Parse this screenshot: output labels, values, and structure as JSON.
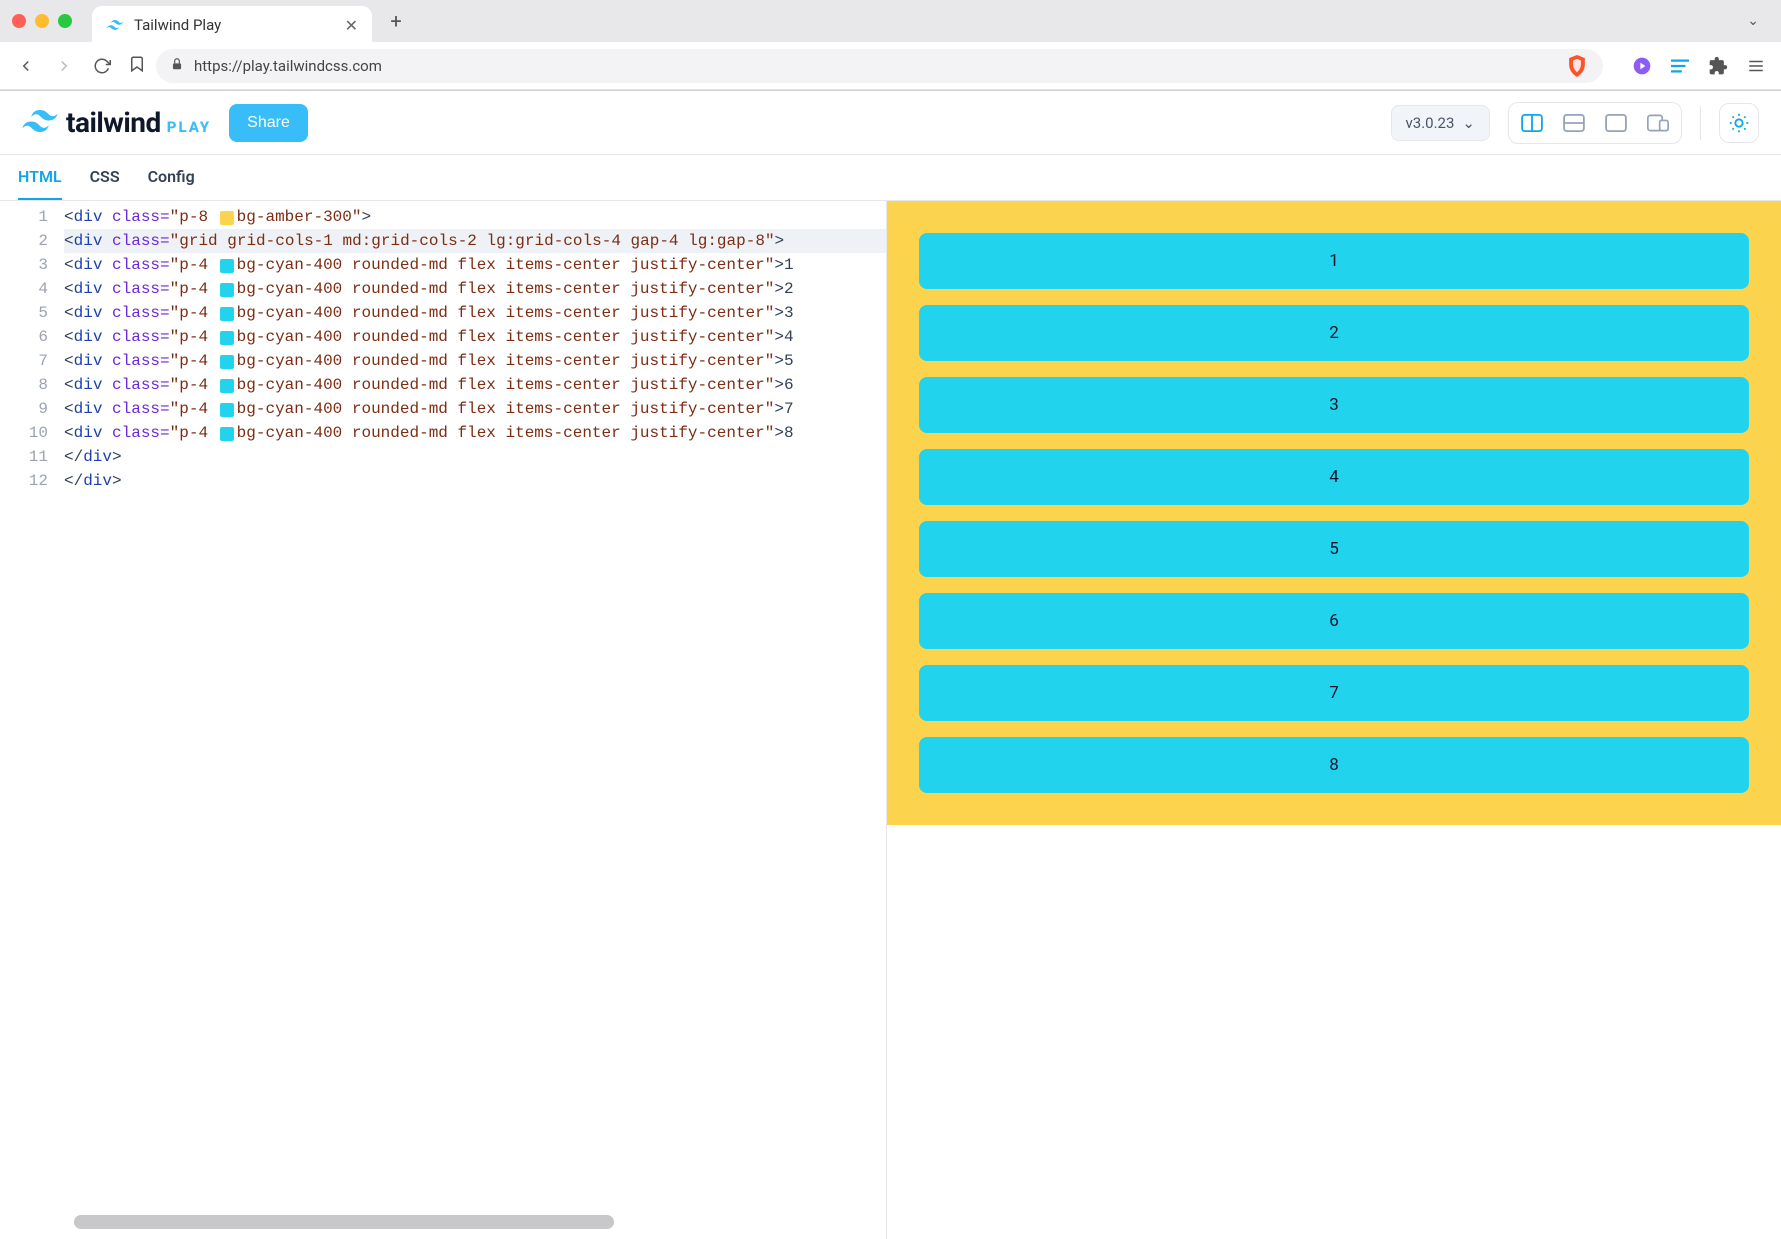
{
  "browser": {
    "tab_title": "Tailwind Play",
    "url": "https://play.tailwindcss.com"
  },
  "header": {
    "logo_text": "tailwind",
    "logo_play": "PLAY",
    "share_label": "Share",
    "version_label": "v3.0.23"
  },
  "editor_tabs": {
    "html": "HTML",
    "css": "CSS",
    "config": "Config"
  },
  "code": {
    "line_numbers": [
      "1",
      "2",
      "3",
      "4",
      "5",
      "6",
      "7",
      "8",
      "9",
      "10",
      "11",
      "12"
    ],
    "l1_class": "p-8 ",
    "l1_class2": "bg-amber-300",
    "l2_class": "grid grid-cols-1 md:grid-cols-2 lg:grid-cols-4 gap-4 lg:gap-8",
    "item_class_a": "p-4 ",
    "item_class_b": "bg-cyan-400 rounded-md flex items-center justify-center",
    "items": [
      "1",
      "2",
      "3",
      "4",
      "5",
      "6",
      "7",
      "8"
    ],
    "close_div1": "div",
    "close_div2": "div"
  },
  "preview": {
    "cards": [
      "1",
      "2",
      "3",
      "4",
      "5",
      "6",
      "7",
      "8"
    ]
  }
}
